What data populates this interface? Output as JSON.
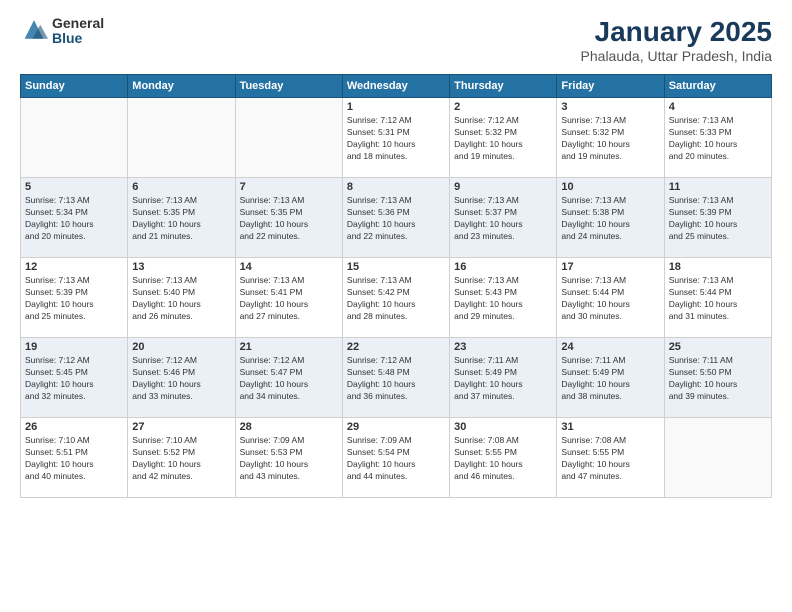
{
  "header": {
    "logo_general": "General",
    "logo_blue": "Blue",
    "title": "January 2025",
    "subtitle": "Phalauda, Uttar Pradesh, India"
  },
  "weekdays": [
    "Sunday",
    "Monday",
    "Tuesday",
    "Wednesday",
    "Thursday",
    "Friday",
    "Saturday"
  ],
  "weeks": [
    [
      {
        "day": "",
        "info": ""
      },
      {
        "day": "",
        "info": ""
      },
      {
        "day": "",
        "info": ""
      },
      {
        "day": "1",
        "info": "Sunrise: 7:12 AM\nSunset: 5:31 PM\nDaylight: 10 hours\nand 18 minutes."
      },
      {
        "day": "2",
        "info": "Sunrise: 7:12 AM\nSunset: 5:32 PM\nDaylight: 10 hours\nand 19 minutes."
      },
      {
        "day": "3",
        "info": "Sunrise: 7:13 AM\nSunset: 5:32 PM\nDaylight: 10 hours\nand 19 minutes."
      },
      {
        "day": "4",
        "info": "Sunrise: 7:13 AM\nSunset: 5:33 PM\nDaylight: 10 hours\nand 20 minutes."
      }
    ],
    [
      {
        "day": "5",
        "info": "Sunrise: 7:13 AM\nSunset: 5:34 PM\nDaylight: 10 hours\nand 20 minutes."
      },
      {
        "day": "6",
        "info": "Sunrise: 7:13 AM\nSunset: 5:35 PM\nDaylight: 10 hours\nand 21 minutes."
      },
      {
        "day": "7",
        "info": "Sunrise: 7:13 AM\nSunset: 5:35 PM\nDaylight: 10 hours\nand 22 minutes."
      },
      {
        "day": "8",
        "info": "Sunrise: 7:13 AM\nSunset: 5:36 PM\nDaylight: 10 hours\nand 22 minutes."
      },
      {
        "day": "9",
        "info": "Sunrise: 7:13 AM\nSunset: 5:37 PM\nDaylight: 10 hours\nand 23 minutes."
      },
      {
        "day": "10",
        "info": "Sunrise: 7:13 AM\nSunset: 5:38 PM\nDaylight: 10 hours\nand 24 minutes."
      },
      {
        "day": "11",
        "info": "Sunrise: 7:13 AM\nSunset: 5:39 PM\nDaylight: 10 hours\nand 25 minutes."
      }
    ],
    [
      {
        "day": "12",
        "info": "Sunrise: 7:13 AM\nSunset: 5:39 PM\nDaylight: 10 hours\nand 25 minutes."
      },
      {
        "day": "13",
        "info": "Sunrise: 7:13 AM\nSunset: 5:40 PM\nDaylight: 10 hours\nand 26 minutes."
      },
      {
        "day": "14",
        "info": "Sunrise: 7:13 AM\nSunset: 5:41 PM\nDaylight: 10 hours\nand 27 minutes."
      },
      {
        "day": "15",
        "info": "Sunrise: 7:13 AM\nSunset: 5:42 PM\nDaylight: 10 hours\nand 28 minutes."
      },
      {
        "day": "16",
        "info": "Sunrise: 7:13 AM\nSunset: 5:43 PM\nDaylight: 10 hours\nand 29 minutes."
      },
      {
        "day": "17",
        "info": "Sunrise: 7:13 AM\nSunset: 5:44 PM\nDaylight: 10 hours\nand 30 minutes."
      },
      {
        "day": "18",
        "info": "Sunrise: 7:13 AM\nSunset: 5:44 PM\nDaylight: 10 hours\nand 31 minutes."
      }
    ],
    [
      {
        "day": "19",
        "info": "Sunrise: 7:12 AM\nSunset: 5:45 PM\nDaylight: 10 hours\nand 32 minutes."
      },
      {
        "day": "20",
        "info": "Sunrise: 7:12 AM\nSunset: 5:46 PM\nDaylight: 10 hours\nand 33 minutes."
      },
      {
        "day": "21",
        "info": "Sunrise: 7:12 AM\nSunset: 5:47 PM\nDaylight: 10 hours\nand 34 minutes."
      },
      {
        "day": "22",
        "info": "Sunrise: 7:12 AM\nSunset: 5:48 PM\nDaylight: 10 hours\nand 36 minutes."
      },
      {
        "day": "23",
        "info": "Sunrise: 7:11 AM\nSunset: 5:49 PM\nDaylight: 10 hours\nand 37 minutes."
      },
      {
        "day": "24",
        "info": "Sunrise: 7:11 AM\nSunset: 5:49 PM\nDaylight: 10 hours\nand 38 minutes."
      },
      {
        "day": "25",
        "info": "Sunrise: 7:11 AM\nSunset: 5:50 PM\nDaylight: 10 hours\nand 39 minutes."
      }
    ],
    [
      {
        "day": "26",
        "info": "Sunrise: 7:10 AM\nSunset: 5:51 PM\nDaylight: 10 hours\nand 40 minutes."
      },
      {
        "day": "27",
        "info": "Sunrise: 7:10 AM\nSunset: 5:52 PM\nDaylight: 10 hours\nand 42 minutes."
      },
      {
        "day": "28",
        "info": "Sunrise: 7:09 AM\nSunset: 5:53 PM\nDaylight: 10 hours\nand 43 minutes."
      },
      {
        "day": "29",
        "info": "Sunrise: 7:09 AM\nSunset: 5:54 PM\nDaylight: 10 hours\nand 44 minutes."
      },
      {
        "day": "30",
        "info": "Sunrise: 7:08 AM\nSunset: 5:55 PM\nDaylight: 10 hours\nand 46 minutes."
      },
      {
        "day": "31",
        "info": "Sunrise: 7:08 AM\nSunset: 5:55 PM\nDaylight: 10 hours\nand 47 minutes."
      },
      {
        "day": "",
        "info": ""
      }
    ]
  ]
}
